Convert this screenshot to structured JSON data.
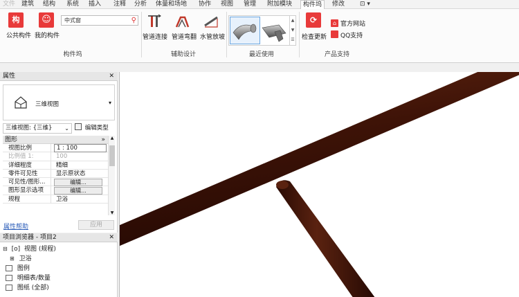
{
  "menubar": {
    "items": [
      {
        "label": "文件",
        "dim": true
      },
      {
        "label": "建筑"
      },
      {
        "label": "结构"
      },
      {
        "label": "系统"
      },
      {
        "label": "插入"
      },
      {
        "label": "注释"
      },
      {
        "label": "分析"
      },
      {
        "label": "体量和场地"
      },
      {
        "label": "协作"
      },
      {
        "label": "视图"
      },
      {
        "label": "管理"
      },
      {
        "label": "附加模块"
      },
      {
        "label": "构件坞",
        "active": true
      },
      {
        "label": "修改"
      },
      {
        "label": "⊡ ▾"
      }
    ]
  },
  "ribbon": {
    "public_components": "公共构件",
    "my_components": "我的构件",
    "search_value": "中式窗",
    "group_component_dock": "构件坞",
    "pipe_connect": "管道连接",
    "pipe_bend": "管道弯翻",
    "pipe_slope": "水管放坡",
    "group_aux_design": "辅助设计",
    "group_recent": "最近使用",
    "check_update": "检查更新",
    "official_site": "官方网站",
    "qq_support": "QQ支持",
    "group_product_support": "产品支持"
  },
  "properties": {
    "title": "属性",
    "type_name": "三维视图",
    "view_select": "三维视图: {三维}",
    "edit_type": "编辑类型",
    "category": "图形",
    "rows": [
      {
        "name": "视图比例",
        "value": "1 : 100",
        "style": "boxed"
      },
      {
        "name": "比例值 1:",
        "value": "100",
        "style": "gray"
      },
      {
        "name": "详细程度",
        "value": "精细"
      },
      {
        "name": "零件可见性",
        "value": "显示原状态"
      },
      {
        "name": "可见性/图形...",
        "value": "编辑...",
        "style": "button"
      },
      {
        "name": "图形显示选项",
        "value": "编辑...",
        "style": "button"
      },
      {
        "name": "规程",
        "value": "卫浴"
      }
    ],
    "help": "属性帮助",
    "apply": "应用"
  },
  "browser": {
    "title": "项目浏览器 - 项目2",
    "root": "视图 (规程)",
    "child": "卫浴",
    "legend": "图例",
    "schedules": "明细表/数量",
    "sheets": "图纸 (全部)"
  },
  "colors": {
    "pipe": "#4a1a0c",
    "brand_red": "#e83a3a",
    "link": "#2a5cb8"
  }
}
